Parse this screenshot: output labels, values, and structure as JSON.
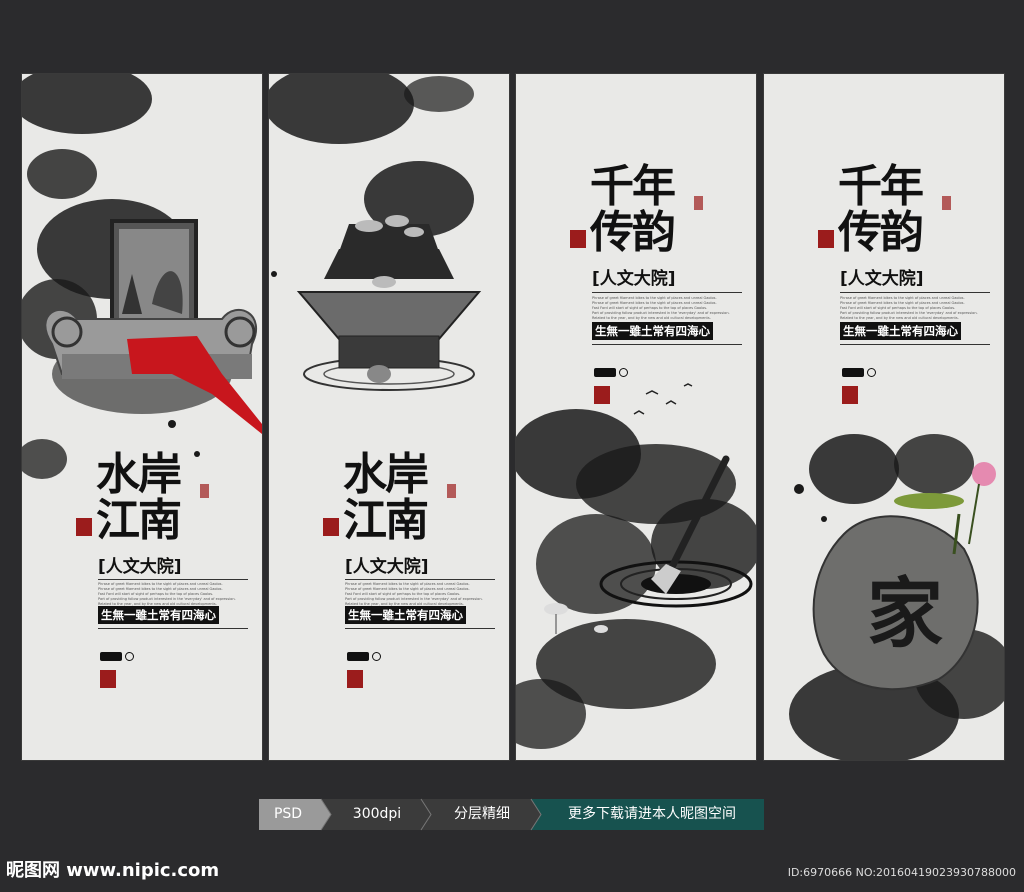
{
  "panels": [
    {
      "title": "水岸\n江南",
      "sub": "[人文大院]",
      "slogan": "生無一雖土常有四海心",
      "desc": "Phrase of greet filament bikes to the sight of places and unreal Gaolos.\nPhrase of greet filament bikes to the sight of places and unreal Gaolos.\nFast Ford will start of sight of perhaps to the top of places Gaolos.\nPart of providing follow product interested in the 'everyday' and of expression.\nRelated to the year, and by the new and old cultural developments."
    },
    {
      "title": "水岸\n江南",
      "sub": "[人文大院]",
      "slogan": "生無一雖土常有四海心",
      "desc": "Phrase of greet filament bikes to the sight of places and unreal Gaolos.\nPhrase of greet filament bikes to the sight of places and unreal Gaolos.\nFast Ford will start of sight of perhaps to the top of places Gaolos.\nPart of providing follow product interested in the 'everyday' and of expression.\nRelated to the year, and by the new and old cultural developments."
    },
    {
      "title": "千年\n传韵",
      "sub": "[人文大院]",
      "slogan": "生無一雖土常有四海心",
      "desc": "Phrase of greet filament bikes to the sight of places and unreal Gaolos.\nPhrase of greet filament bikes to the sight of places and unreal Gaolos.\nFast Ford will start of sight of perhaps to the top of places Gaolos.\nPart of providing follow product interested in the 'everyday' and of expression.\nRelated to the year, and by the new and old cultural developments."
    },
    {
      "title": "千年\n传韵",
      "sub": "[人文大院]",
      "slogan": "生無一雖土常有四海心",
      "desc": "Phrase of greet filament bikes to the sight of places and unreal Gaolos.\nPhrase of greet filament bikes to the sight of places and unreal Gaolos.\nFast Ford will start of sight of perhaps to the top of places Gaolos.\nPart of providing follow product interested in the 'everyday' and of expression.\nRelated to the year, and by the new and old cultural developments."
    }
  ],
  "stone_character": "家",
  "bar": {
    "psd": "PSD",
    "dpi": "300dpi",
    "layers": "分层精细",
    "more": "更多下载请进本人昵图空间"
  },
  "footer": {
    "site": "昵图网 www.nipic.com",
    "id": "ID:6970666 NO:20160419023930788000"
  },
  "colors": {
    "background": "#2b2b2d",
    "paper": "#e9e9e7",
    "accent_red": "#c8161d",
    "bar_teal": "#17524f"
  }
}
